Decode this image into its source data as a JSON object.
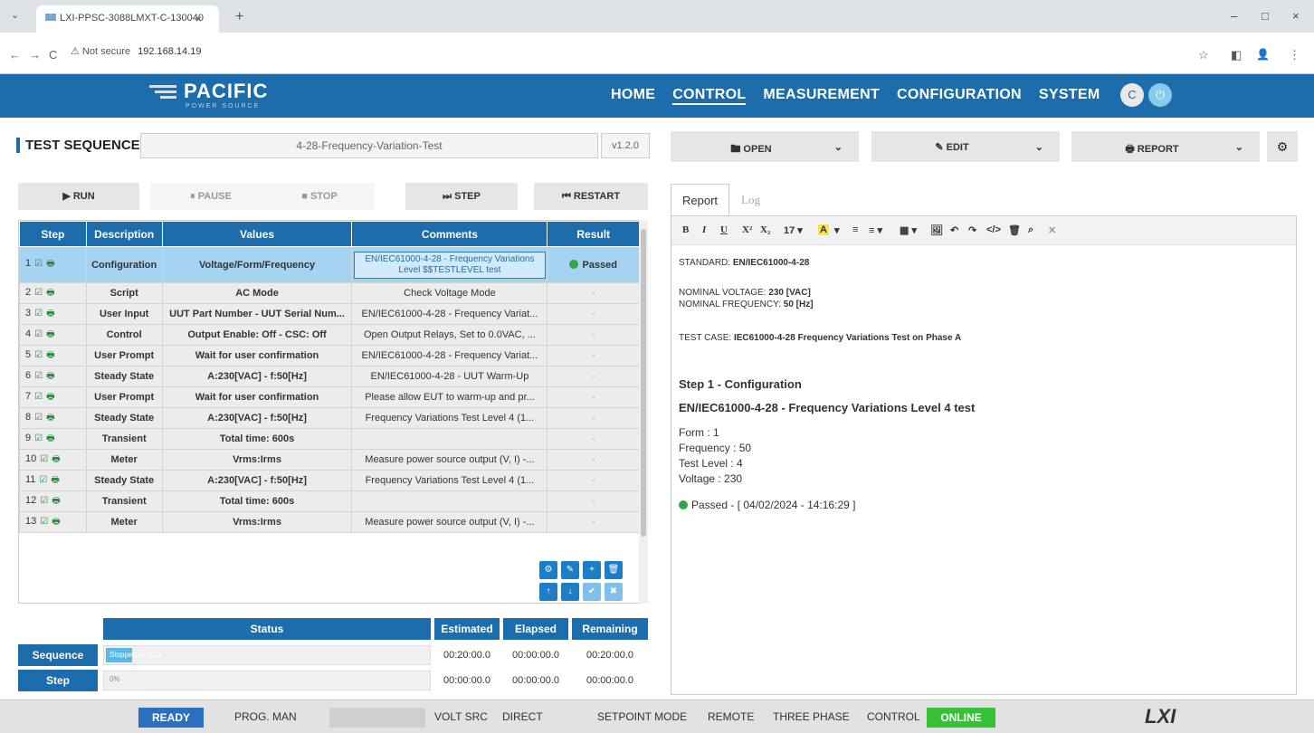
{
  "browser": {
    "tab_title": "LXI-PPSC-3088LMXT-C-130040",
    "close": "×",
    "new_tab": "+",
    "tabs_menu": "⌄",
    "minimize": "–",
    "maximize": "□",
    "close_win": "×",
    "back": "←",
    "forward": "→",
    "reload": "C",
    "security": "⚠ Not secure",
    "url": "192.168.14.19",
    "star": "☆",
    "sidebar": "◧",
    "profile": "👤",
    "menu": "⋮"
  },
  "app": {
    "brand": "PACIFIC",
    "brand_sub": "POWER SOURCE",
    "nav": [
      "HOME",
      "CONTROL",
      "MEASUREMENT",
      "CONFIGURATION",
      "SYSTEM"
    ],
    "circ1": "C",
    "circ2": "⏻"
  },
  "test_sequence": {
    "title": "TEST SEQUENCE",
    "name": "4-28-Frequency-Variation-Test",
    "version": "v1.2.0"
  },
  "toolbar": {
    "open": "🖿 OPEN",
    "edit": "✎ EDIT",
    "report": "🖶 REPORT",
    "dd": "⌄",
    "gear": "⚙"
  },
  "controls": {
    "run": "▶ RUN",
    "pause": "⏸ PAUSE",
    "stop": "■ STOP",
    "step": "⏭ STEP",
    "restart": "⏮ RESTART"
  },
  "table": {
    "headers": [
      "Step",
      "Description",
      "Values",
      "Comments",
      "Result"
    ],
    "rows": [
      {
        "step": "1",
        "desc": "Configuration",
        "values": "Voltage/Form/Frequency",
        "comments": "EN/IEC61000-4-28 - Frequency Variations Level $$TESTLEVEL test",
        "result": "Passed"
      },
      {
        "step": "2",
        "desc": "Script",
        "values": "AC Mode",
        "comments": "Check Voltage Mode",
        "result": "-"
      },
      {
        "step": "3",
        "desc": "User Input",
        "values": "UUT Part Number - UUT Serial Num...",
        "comments": "EN/IEC61000-4-28 - Frequency Variat...",
        "result": "-"
      },
      {
        "step": "4",
        "desc": "Control",
        "values": "Output Enable: Off - CSC: Off",
        "comments": "Open Output Relays, Set to 0.0VAC, ...",
        "result": "-"
      },
      {
        "step": "5",
        "desc": "User Prompt",
        "values": "Wait for user confirmation",
        "comments": "EN/IEC61000-4-28 - Frequency Variat...",
        "result": "-"
      },
      {
        "step": "6",
        "desc": "Steady State",
        "values": "A:230[VAC] - f:50[Hz]",
        "comments": "EN/IEC61000-4-28 - UUT Warm-Up",
        "result": "-"
      },
      {
        "step": "7",
        "desc": "User Prompt",
        "values": "Wait for user confirmation",
        "comments": "Please allow EUT to warm-up and pr...",
        "result": "-"
      },
      {
        "step": "8",
        "desc": "Steady State",
        "values": "A:230[VAC] - f:50[Hz]",
        "comments": "Frequency Variations Test Level 4 (1...",
        "result": "-"
      },
      {
        "step": "9",
        "desc": "Transient",
        "values": "Total time: 600s",
        "comments": "",
        "result": "-"
      },
      {
        "step": "10",
        "desc": "Meter",
        "values": "Vrms:Irms",
        "comments": "Measure power source output (V, I) -...",
        "result": "-"
      },
      {
        "step": "11",
        "desc": "Steady State",
        "values": "A:230[VAC] - f:50[Hz]",
        "comments": "Frequency Variations Test Level 4 (1...",
        "result": "-"
      },
      {
        "step": "12",
        "desc": "Transient",
        "values": "Total time: 600s",
        "comments": "",
        "result": "-"
      },
      {
        "step": "13",
        "desc": "Meter",
        "values": "Vrms:Irms",
        "comments": "Measure power source output (V, I) -...",
        "result": "-"
      }
    ],
    "row_tools": [
      "⚙",
      "✎",
      "+",
      "🗑",
      "↑",
      "↓",
      "✔",
      "✖"
    ]
  },
  "status": {
    "headers": [
      "Status",
      "Estimated",
      "Elapsed",
      "Remaining"
    ],
    "sequence": {
      "label": "Sequence",
      "bar_text": "Stopped at 1/13",
      "progress": 0.08,
      "estimated": "00:20:00.0",
      "elapsed": "00:00:00.0",
      "remaining": "00:20:00.0"
    },
    "step": {
      "label": "Step",
      "bar_text": "0%",
      "estimated": "00:00:00.0",
      "elapsed": "00:00:00.0",
      "remaining": "00:00:00.0"
    }
  },
  "report": {
    "tab_report": "Report",
    "tab_log": "Log",
    "tools": [
      "B",
      "I",
      "U",
      "X²",
      "X₂",
      "17 ▾",
      "A",
      "▾",
      "≡",
      "≡ ▾",
      "▦ ▾",
      "🖼",
      "↶",
      "↷",
      "</>",
      "🗑",
      "⌕",
      "✕"
    ],
    "standard_label": "STANDARD: ",
    "standard": "EN/IEC61000-4-28",
    "nom_v_label": "NOMINAL VOLTAGE: ",
    "nom_v": "230 [VAC]",
    "nom_f_label": "NOMINAL FREQUENCY: ",
    "nom_f": "50 [Hz]",
    "case_label": "TEST CASE: ",
    "case": "IEC61000-4-28 Frequency Variations Test on Phase A",
    "step_title": "Step 1 - Configuration",
    "step_sub": "EN/IEC61000-4-28 - Frequency Variations Level 4 test",
    "form": "Form : 1",
    "freq": "Frequency : 50",
    "level": "Test Level : 4",
    "voltage": "Voltage : 230",
    "result": "Passed - [ 04/02/2024 - 14:16:29 ]"
  },
  "footer": {
    "ready": "READY",
    "prog": "PROG. MAN",
    "volt_src": "VOLT SRC",
    "direct": "DIRECT",
    "setpoint": "SETPOINT MODE",
    "remote": "REMOTE",
    "three_phase": "THREE PHASE",
    "control": "CONTROL",
    "online": "ONLINE",
    "lxi": "LXI"
  }
}
